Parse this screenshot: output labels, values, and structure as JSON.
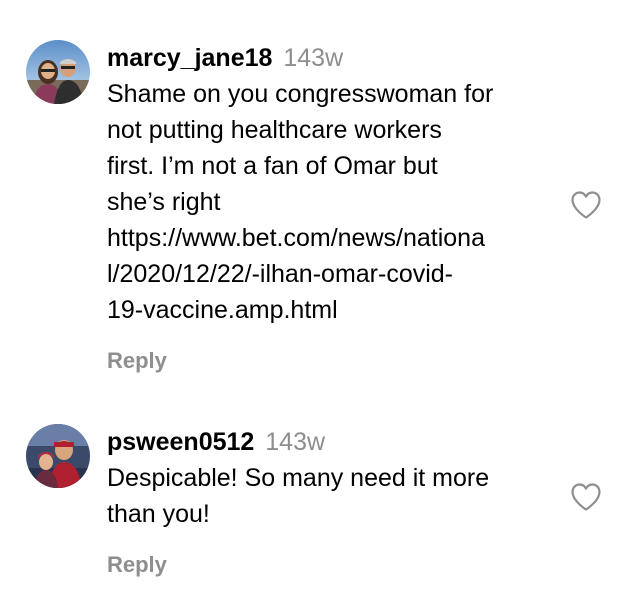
{
  "comments": [
    {
      "username": "marcy_jane18",
      "time": "143w",
      "lines": [
        "Shame on you congresswoman for",
        "not putting healthcare workers",
        "first. I’m not a fan of Omar but",
        "she’s right",
        "https://www.bet.com/news/nationa",
        "l/2020/12/22/-ilhan-omar-covid-",
        "19-vaccine.amp.html"
      ],
      "reply_label": "Reply",
      "avatar_icon": "user-avatar-couple",
      "like_icon": "heart-outline-icon"
    },
    {
      "username": "psween0512",
      "time": "143w",
      "lines": [
        "Despicable! So many need it more",
        "than you!"
      ],
      "reply_label": "Reply",
      "avatar_icon": "user-avatar-family",
      "like_icon": "heart-outline-icon"
    }
  ],
  "colors": {
    "primary_text": "#000000",
    "secondary_text": "#8e8e8e",
    "icon_stroke": "#8e8e8e"
  }
}
